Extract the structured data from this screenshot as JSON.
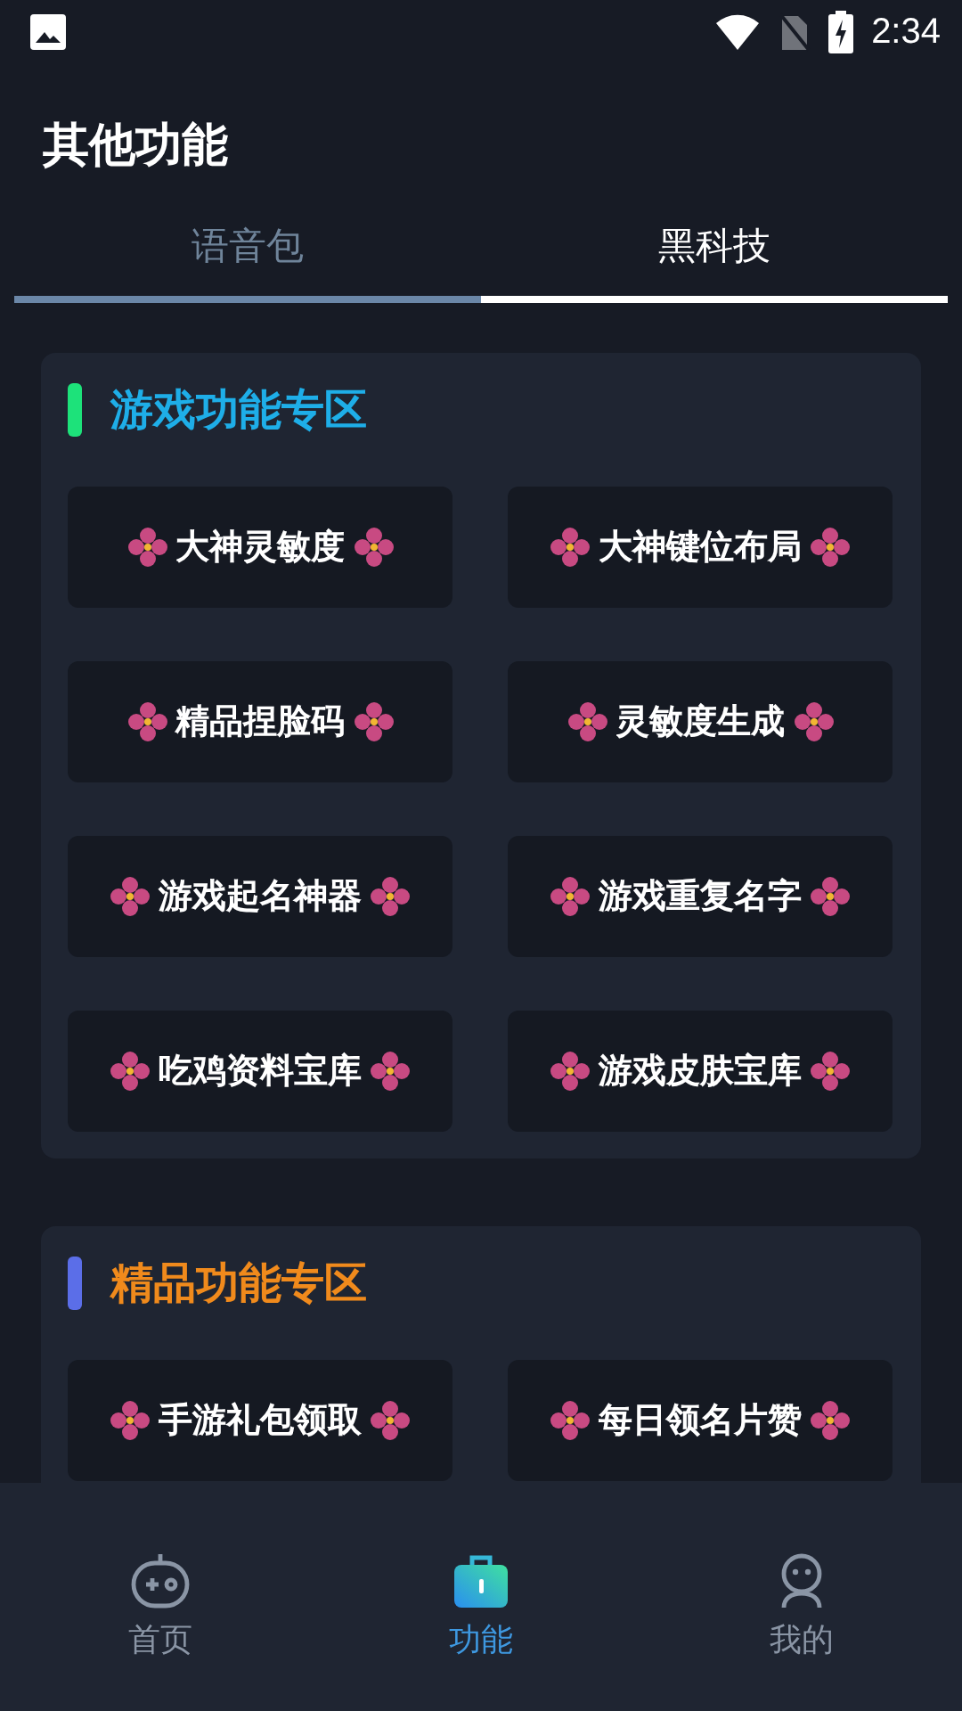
{
  "status_bar": {
    "time": "2:34"
  },
  "header": {
    "title": "其他功能"
  },
  "tabs": [
    {
      "label": "语音包",
      "selected": false
    },
    {
      "label": "黑科技",
      "selected": true
    }
  ],
  "sections": [
    {
      "title": "游戏功能专区",
      "kind": "game",
      "color": "#1de27a",
      "items": [
        "大神灵敏度",
        "大神键位布局",
        "精品捏脸码",
        "灵敏度生成",
        "游戏起名神器",
        "游戏重复名字",
        "吃鸡资料宝库",
        "游戏皮肤宝库"
      ]
    },
    {
      "title": "精品功能专区",
      "kind": "premium",
      "color": "#5b6ee8",
      "items": [
        "手游礼包领取",
        "每日领名片赞"
      ]
    }
  ],
  "bottom_nav": [
    {
      "kind": "gamepad",
      "label": "首页",
      "selected": false
    },
    {
      "kind": "briefcase",
      "label": "功能",
      "selected": true
    },
    {
      "kind": "person",
      "label": "我的",
      "selected": false
    }
  ]
}
